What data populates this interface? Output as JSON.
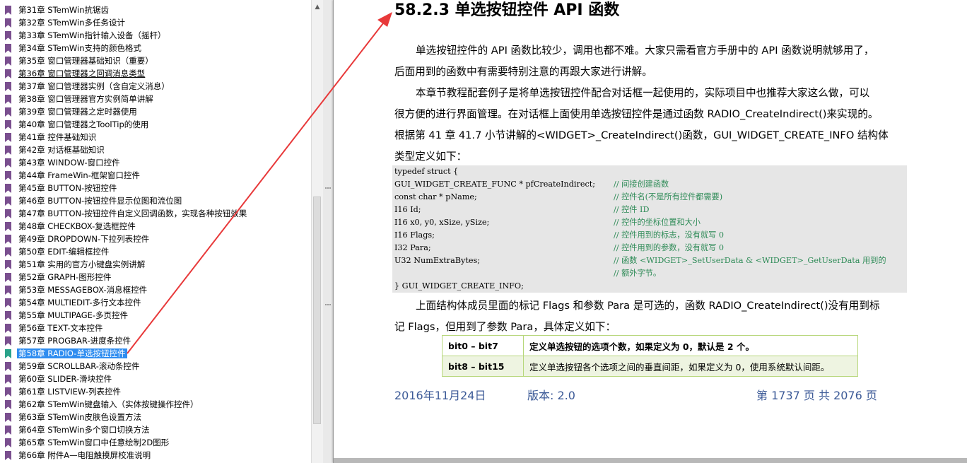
{
  "sidebar": {
    "items": [
      {
        "label": "第31章 STemWin抗锯齿"
      },
      {
        "label": "第32章 STemWin多任务设计"
      },
      {
        "label": "第33章 STemWin指针输入设备（摇杆）"
      },
      {
        "label": "第34章 STemWin支持的颜色格式"
      },
      {
        "label": "第35章 窗口管理器基础知识（重要）"
      },
      {
        "label": "第36章 窗口管理器之回调消息类型"
      },
      {
        "label": "第37章 窗口管理器实例（含自定义消息）"
      },
      {
        "label": "第38章 窗口管理器官方实例简单讲解"
      },
      {
        "label": "第39章 窗口管理器之定时器使用"
      },
      {
        "label": "第40章 窗口管理器之ToolTip的使用"
      },
      {
        "label": "第41章 控件基础知识"
      },
      {
        "label": "第42章 对话框基础知识"
      },
      {
        "label": "第43章 WINDOW-窗口控件"
      },
      {
        "label": "第44章 FrameWin-框架窗口控件"
      },
      {
        "label": "第45章 BUTTON-按钮控件"
      },
      {
        "label": "第46章 BUTTON-按钮控件显示位图和流位图"
      },
      {
        "label": "第47章 BUTTON-按钮控件自定义回调函数，实现各种按钮效果"
      },
      {
        "label": "第48章 CHECKBOX-复选框控件"
      },
      {
        "label": "第49章 DROPDOWN-下拉列表控件"
      },
      {
        "label": "第50章 EDIT-编辑框控件"
      },
      {
        "label": "第51章 实用的官方小键盘实例讲解"
      },
      {
        "label": "第52章 GRAPH-图形控件"
      },
      {
        "label": "第53章 MESSAGEBOX-消息框控件"
      },
      {
        "label": "第54章 MULTIEDIT-多行文本控件"
      },
      {
        "label": "第55章 MULTIPAGE-多页控件"
      },
      {
        "label": "第56章 TEXT-文本控件"
      },
      {
        "label": "第57章 PROGBAR-进度条控件"
      },
      {
        "label": "第58章 RADIO-单选按钮控件"
      },
      {
        "label": "第59章 SCROLLBAR-滚动条控件"
      },
      {
        "label": "第60章 SLIDER-滑块控件"
      },
      {
        "label": "第61章 LISTVIEW-列表控件"
      },
      {
        "label": "第62章 STemWin键盘输入（实体按键操作控件）"
      },
      {
        "label": "第63章 STemWin皮肤色设置方法"
      },
      {
        "label": "第64章 STemWin多个窗口切换方法"
      },
      {
        "label": "第65章 STemWin窗口中任意绘制2D图形"
      },
      {
        "label": "第66章 附件A—电阻触摸屏校准说明"
      }
    ],
    "selected_index": 27
  },
  "doc": {
    "heading": "58.2.3 单选按钮控件 API 函数",
    "para1": [
      "单选按钮控件的 API 函数比较少，调用也都不难。大家只需看官方手册中的 API 函数说明就够用了，",
      "后面用到的函数中有需要特别注意的再跟大家进行讲解。"
    ],
    "para2": [
      "本章节教程配套例子是将单选按钮控件配合对话框一起使用的，实际项目中也推荐大家这么做，可以",
      "很方便的进行界面管理。在对话框上面使用单选按钮控件是通过函数 RADIO_CreateIndirect()来实现的。",
      "根据第 41 章 41.7 小节讲解的<WIDGET>_CreateIndirect()函数，GUI_WIDGET_CREATE_INFO 结构体",
      "类型定义如下："
    ],
    "code_lines": [
      {
        "code": "typedef struct {",
        "comment": ""
      },
      {
        "code": "GUI_WIDGET_CREATE_FUNC * pfCreateIndirect;",
        "comment": "// 间接创建函数"
      },
      {
        "code": "const char * pName;",
        "comment": "// 控件名(不是所有控件都需要)"
      },
      {
        "code": "I16 Id;",
        "comment": "// 控件 ID"
      },
      {
        "code": "I16 x0, y0, xSize, ySize;",
        "comment": "// 控件的坐标位置和大小"
      },
      {
        "code": "I16 Flags;",
        "comment": "// 控件用到的标志，没有就写 0"
      },
      {
        "code": "I32 Para;",
        "comment": "// 控件用到的参数，没有就写 0"
      },
      {
        "code": "U32 NumExtraBytes;",
        "comment": "// 函数 <WIDGET>_SetUserData & <WIDGET>_GetUserData 用到的"
      },
      {
        "code": "",
        "comment": "// 额外字节。"
      },
      {
        "code": "} GUI_WIDGET_CREATE_INFO;",
        "comment": ""
      }
    ],
    "para3": [
      "上面结构体成员里面的标记 Flags 和参数 Para 是可选的，函数 RADIO_CreateIndirect()没有用到标",
      "记 Flags，但用到了参数 Para，具体定义如下："
    ],
    "table": [
      {
        "key": "bit0 – bit7",
        "value": "定义单选按钮的选项个数，如果定义为 0，默认是 2 个。"
      },
      {
        "key": "bit8 – bit15",
        "value": "定义单选按钮各个选项之间的垂直间距，如果定义为 0，使用系统默认间距。"
      }
    ],
    "footer": {
      "date": "2016年11月24日",
      "version": "版本: 2.0",
      "page": "第 1737 页  共 2076 页"
    }
  },
  "colors": {
    "selection": "#2f8df0",
    "bookmark": "#7a4f8f",
    "arrow": "#e8393a",
    "footer_text": "#3c5a97",
    "code_bg": "#e6e6e6",
    "comment": "#2e8b57"
  },
  "icons": {
    "bookmark": "bookmark-icon",
    "scroll_up": "arrow-up-icon"
  }
}
